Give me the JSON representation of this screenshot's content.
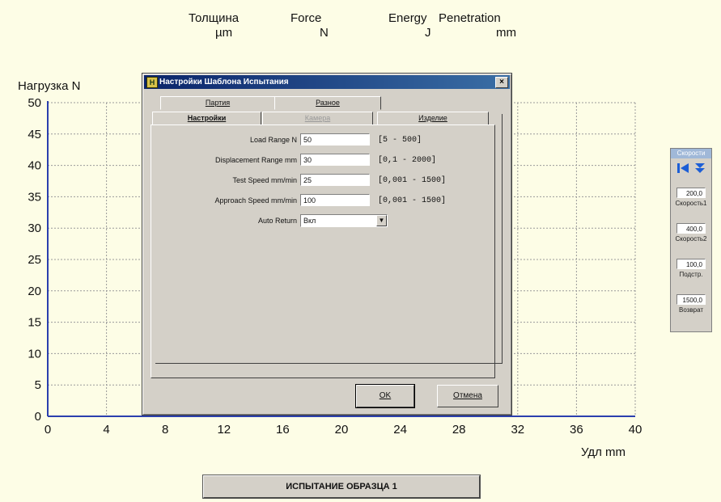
{
  "header": {
    "columns": [
      {
        "name": "Толщина",
        "unit": "µm"
      },
      {
        "name": "Force",
        "unit": "N"
      },
      {
        "name": "Energy",
        "unit": "J"
      },
      {
        "name": "Penetration",
        "unit": "mm"
      }
    ]
  },
  "chart_data": {
    "type": "line",
    "ylabel": "Нагрузка N",
    "xlabel": "Удл mm",
    "xlim": [
      0,
      40
    ],
    "ylim": [
      0,
      50
    ],
    "x_ticks": [
      0,
      4,
      8,
      12,
      16,
      20,
      24,
      28,
      32,
      36,
      40
    ],
    "y_ticks": [
      0,
      5,
      10,
      15,
      20,
      25,
      30,
      35,
      40,
      45,
      50
    ],
    "grid": true,
    "series": []
  },
  "dialog": {
    "title": "Настройки Шаблона Испытания",
    "close": "×",
    "app_icon": "Н",
    "tabs_back": [
      "Партия",
      "Разное"
    ],
    "tabs_front": [
      "Настройки",
      "Камера",
      "Изделие"
    ],
    "fields": [
      {
        "label": "Load Range N",
        "value": "50",
        "range": "[5 - 500]"
      },
      {
        "label": "Displacement Range mm",
        "value": "30",
        "range": "[0,1 - 2000]"
      },
      {
        "label": "Test Speed mm/min",
        "value": "25",
        "range": "[0,001 - 1500]"
      },
      {
        "label": "Approach Speed mm/min",
        "value": "100",
        "range": "[0,001 - 1500]"
      }
    ],
    "auto_return": {
      "label": "Auto Return",
      "value": "Вкл"
    },
    "ok_label": "OK",
    "cancel_label": "Отмена"
  },
  "side_panel": {
    "title": "Скорости",
    "items": [
      {
        "value": "200,0",
        "label": "Скорость1"
      },
      {
        "value": "400,0",
        "label": "Скорость2"
      },
      {
        "value": "100,0",
        "label": "Подстр."
      },
      {
        "value": "1500,0",
        "label": "Возврат"
      }
    ]
  },
  "bottom_button": "ИСПЫТАНИЕ ОБРАЗЦА 1",
  "colors": {
    "background": "#fdfde6",
    "axis": "#2b3fae",
    "grid": "#9a9a9a",
    "dialog": "#d4d0c8"
  }
}
